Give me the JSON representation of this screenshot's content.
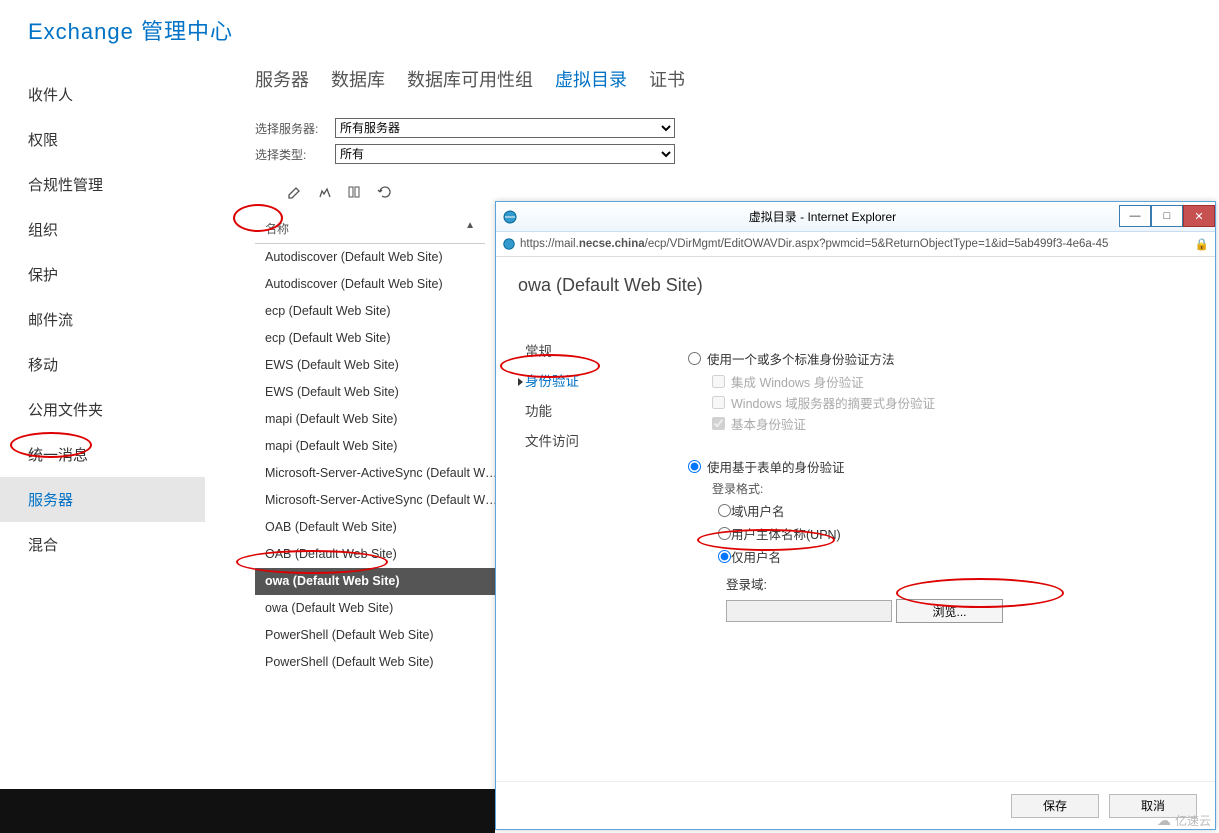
{
  "header": {
    "title": "Exchange 管理中心"
  },
  "leftnav": {
    "items": [
      "收件人",
      "权限",
      "合规性管理",
      "组织",
      "保护",
      "邮件流",
      "移动",
      "公用文件夹",
      "统一消息",
      "服务器",
      "混合"
    ],
    "active_index": 9
  },
  "tabs": {
    "items": [
      "服务器",
      "数据库",
      "数据库可用性组",
      "虚拟目录",
      "证书"
    ],
    "active_index": 3
  },
  "filters": {
    "server_label": "选择服务器:",
    "server_value": "所有服务器",
    "type_label": "选择类型:",
    "type_value": "所有"
  },
  "list_header": {
    "name": "名称"
  },
  "vdirs": {
    "items": [
      "Autodiscover (Default Web Site)",
      "Autodiscover (Default Web Site)",
      "ecp (Default Web Site)",
      "ecp (Default Web Site)",
      "EWS (Default Web Site)",
      "EWS (Default Web Site)",
      "mapi (Default Web Site)",
      "mapi (Default Web Site)",
      "Microsoft-Server-ActiveSync (Default We...",
      "Microsoft-Server-ActiveSync (Default We...",
      "OAB (Default Web Site)",
      "OAB (Default Web Site)",
      "owa (Default Web Site)",
      "owa (Default Web Site)",
      "PowerShell (Default Web Site)",
      "PowerShell (Default Web Site)"
    ],
    "selected_index": 12
  },
  "ie": {
    "title": "虚拟目录 - Internet Explorer",
    "url_prefix": "https://mail.",
    "url_bold": "necse.china",
    "url_rest": "/ecp/VDirMgmt/EditOWAVDir.aspx?pwmcid=5&ReturnObjectType=1&id=5ab499f3-4e6a-45"
  },
  "dialog": {
    "title": "owa (Default Web Site)",
    "nav": [
      "常规",
      "身份验证",
      "功能",
      "文件访问"
    ],
    "nav_active_index": 1,
    "auth": {
      "standard_label": "使用一个或多个标准身份验证方法",
      "iwa_label": "集成 Windows 身份验证",
      "digest_label": "Windows 域服务器的摘要式身份验证",
      "basic_label": "基本身份验证",
      "forms_label": "使用基于表单的身份验证",
      "login_format_label": "登录格式:",
      "fmt_domainuser": "域\\用户名",
      "fmt_upn": "用户主体名称(UPN)",
      "fmt_useronly": "仅用户名",
      "logon_domain_label": "登录域:",
      "browse_label": "浏览..."
    },
    "footer": {
      "save": "保存",
      "cancel": "取消"
    }
  },
  "watermark": {
    "text": "亿速云"
  }
}
